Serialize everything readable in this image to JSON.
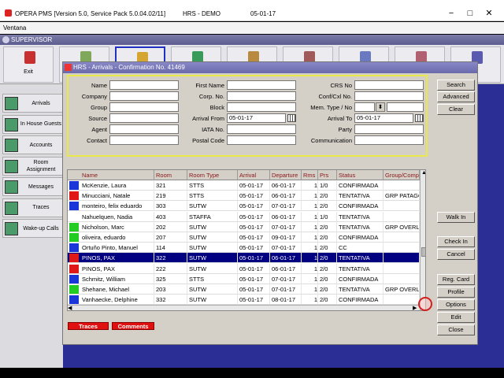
{
  "window": {
    "title": "OPERA PMS [Version 5.0, Service Pack 5.0.04.02/11]",
    "hotel": "HRS - DEMO",
    "date": "05-01-17",
    "minimize": "−",
    "maximize": "□",
    "close": "✕"
  },
  "menu": {
    "item": "Ventana"
  },
  "user_bar": {
    "label": "SUPERVISOR"
  },
  "toolbar": {
    "buttons": [
      {
        "label": "Exit",
        "icon": "exit-icon",
        "color": "#c83030"
      },
      {
        "label": "",
        "icon": "reservation-icon",
        "color": "#7fa85a"
      },
      {
        "label": "",
        "icon": "front-desk-icon",
        "color": "#d4a530"
      },
      {
        "label": "",
        "icon": "cashiering-icon",
        "color": "#3a9a5a"
      },
      {
        "label": "",
        "icon": "rooms-mgmt-icon",
        "color": "#b88a40"
      },
      {
        "label": "",
        "icon": "ar-icon",
        "color": "#a05a5a"
      },
      {
        "label": "",
        "icon": "commissions-icon",
        "color": "#6a7ac0"
      },
      {
        "label": "",
        "icon": "reports-icon",
        "color": "#b06070"
      },
      {
        "label": "",
        "icon": "misc-icon",
        "color": "#5a5ab0"
      }
    ]
  },
  "sidebar": {
    "items": [
      {
        "label": "Arrivals",
        "icon": "arrivals-icon"
      },
      {
        "label": "In House Guests",
        "icon": "in-house-icon"
      },
      {
        "label": "Accounts",
        "icon": "accounts-icon"
      },
      {
        "label": "Room Assignment",
        "icon": "room-assignment-icon"
      },
      {
        "label": "Messages",
        "icon": "messages-icon"
      },
      {
        "label": "Traces",
        "icon": "traces-icon"
      },
      {
        "label": "Wake-up Calls",
        "icon": "wakeup-icon"
      }
    ]
  },
  "dialog": {
    "title": "HRS - Arrivals - Confirmation No. 41469",
    "search": {
      "name_label": "Name",
      "name_value": "",
      "company_label": "Company",
      "company_value": "",
      "group_label": "Group",
      "group_value": "",
      "source_label": "Source",
      "source_value": "",
      "agent_label": "Agent",
      "agent_value": "",
      "contact_label": "Contact",
      "contact_value": "",
      "first_name_label": "First Name",
      "first_name_value": "",
      "corp_no_label": "Corp. No.",
      "corp_no_value": "",
      "block_label": "Block",
      "block_value": "",
      "arrival_from_label": "Arrival From",
      "arrival_from_value": "05-01-17",
      "iata_label": "IATA No.",
      "iata_value": "",
      "postal_label": "Postal Code",
      "postal_value": "",
      "crs_label": "CRS No",
      "crs_value": "",
      "conf_label": "Conf/Cxl No.",
      "conf_value": "",
      "mem_label": "Mem. Type / No",
      "mem_value": "",
      "mem_no_value": "",
      "arrival_to_label": "Arrival To",
      "arrival_to_value": "05-01-17",
      "party_label": "Party",
      "party_value": "",
      "comm_label": "Communication",
      "comm_value": ""
    },
    "buttons": {
      "search": "Search",
      "advanced": "Advanced",
      "clear": "Clear",
      "walk_in": "Walk In",
      "check_in": "Check In",
      "cancel": "Cancel",
      "reg_card": "Reg. Card",
      "profile": "Profile",
      "options": "Options",
      "edit": "Edit",
      "close": "Close"
    },
    "grid": {
      "columns": [
        "Name",
        "Room",
        "Room Type",
        "Arrival",
        "Departure",
        "Rms",
        "Prs",
        "Status",
        "Group/Comp"
      ],
      "rows": [
        {
          "color": "#1a35d8",
          "name": "McKenzie, Laura",
          "room": "321",
          "type": "STTS",
          "arrival": "05-01-17",
          "departure": "06-01-17",
          "rms": "1",
          "prs": "1/0",
          "status": "CONFIRMADA",
          "group": ""
        },
        {
          "color": "#e01818",
          "name": "Minucciani, Natale",
          "room": "219",
          "type": "STTS",
          "arrival": "05-01-17",
          "departure": "06-01-17",
          "rms": "1",
          "prs": "2/0",
          "status": "TENTATIVA",
          "group": "GRP PATAGO"
        },
        {
          "color": "#1a35d8",
          "name": "monteiro, felix eduardo",
          "room": "303",
          "type": "SUTW",
          "arrival": "05-01-17",
          "departure": "07-01-17",
          "rms": "1",
          "prs": "2/0",
          "status": "CONFIRMADA",
          "group": ""
        },
        {
          "color": "#ffffff",
          "name": "Nahuelquen, Nadia",
          "room": "403",
          "type": "STAFFA",
          "arrival": "05-01-17",
          "departure": "06-01-17",
          "rms": "1",
          "prs": "1/0",
          "status": "TENTATIVA",
          "group": ""
        },
        {
          "color": "#22cc22",
          "name": "Nicholson, Marc",
          "room": "202",
          "type": "SUTW",
          "arrival": "05-01-17",
          "departure": "07-01-17",
          "rms": "1",
          "prs": "2/0",
          "status": "TENTATIVA",
          "group": "GRP OVERLA"
        },
        {
          "color": "#22cc22",
          "name": "oliveira, eduardo",
          "room": "207",
          "type": "SUTW",
          "arrival": "05-01-17",
          "departure": "09-01-17",
          "rms": "1",
          "prs": "2/0",
          "status": "CONFIRMADA",
          "group": ""
        },
        {
          "color": "#1a35d8",
          "name": "Ortuño Pinto, Manuel",
          "room": "114",
          "type": "SUTW",
          "arrival": "05-01-17",
          "departure": "07-01-17",
          "rms": "1",
          "prs": "2/0",
          "status": "CC",
          "group": ""
        },
        {
          "color": "#e01818",
          "name": "PINOS, PAX",
          "room": "322",
          "type": "SUTW",
          "arrival": "05-01-17",
          "departure": "06-01-17",
          "rms": "1",
          "prs": "2/0",
          "status": "TENTATIVA",
          "group": "",
          "selected": true
        },
        {
          "color": "#e01818",
          "name": "PINOS, PAX",
          "room": "222",
          "type": "SUTW",
          "arrival": "05-01-17",
          "departure": "06-01-17",
          "rms": "1",
          "prs": "2/0",
          "status": "TENTATIVA",
          "group": ""
        },
        {
          "color": "#1a35d8",
          "name": "Schmitz, William",
          "room": "325",
          "type": "STTS",
          "arrival": "05-01-17",
          "departure": "07-01-17",
          "rms": "1",
          "prs": "2/0",
          "status": "CONFIRMADA",
          "group": ""
        },
        {
          "color": "#22cc22",
          "name": "Shehane, Michael",
          "room": "203",
          "type": "SUTW",
          "arrival": "05-01-17",
          "departure": "07-01-17",
          "rms": "1",
          "prs": "2/0",
          "status": "TENTATIVA",
          "group": "GRP OVERLA"
        },
        {
          "color": "#1a35d8",
          "name": "Vanhaecke, Delphine",
          "room": "332",
          "type": "SUTW",
          "arrival": "05-01-17",
          "departure": "08-01-17",
          "rms": "1",
          "prs": "2/0",
          "status": "CONFIRMADA",
          "group": ""
        }
      ]
    },
    "footer": {
      "traces": "Traces",
      "comments": "Comments"
    }
  }
}
